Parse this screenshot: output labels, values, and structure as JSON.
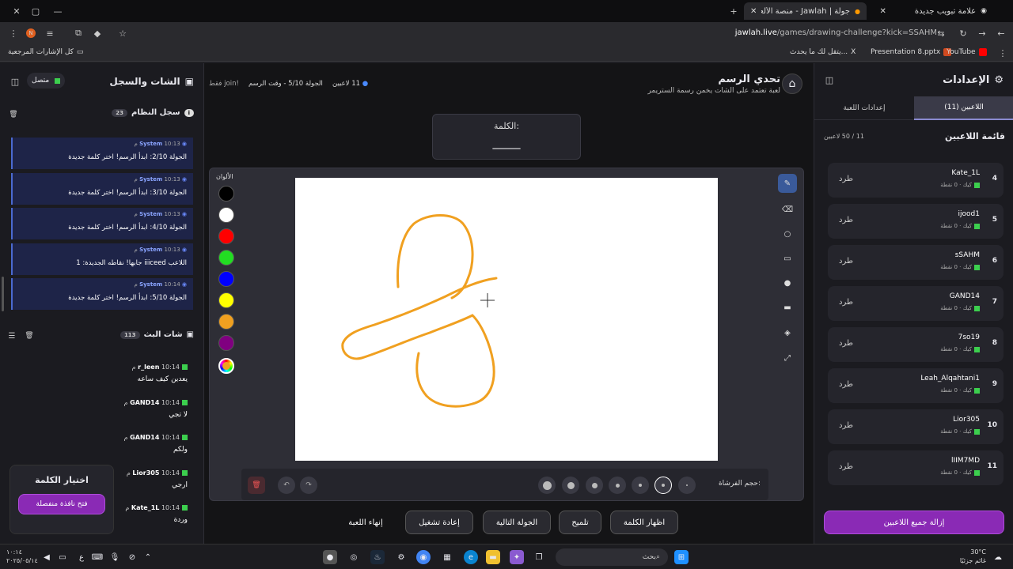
{
  "browser": {
    "tabs": [
      {
        "label": "علامة تبويب جديدة",
        "active": false
      },
      {
        "label": "جولة | Jawlah - منصة الألعاب الت...",
        "active": true
      }
    ],
    "url_host": "jawlah.live",
    "url_path": "/games/drawing-challenge?kick=SSAHM",
    "bookmarks": [
      "YouTube",
      "Presentation 8.pptx",
      "يتقل لك ما يحدث...",
      "كل الإشارات المرجعية"
    ],
    "bookmark_x": "X"
  },
  "settings": {
    "title": "الإعدادات",
    "tab_players": "اللاعبين (11)",
    "tab_game": "إعدادات اللعبة",
    "list_title": "قائمة اللاعبين",
    "list_count": "11 / 50 لاعبين",
    "kick_label": "طرد",
    "meta_platform": "كيك",
    "meta_points": "0 نقطة",
    "players": [
      {
        "idx": "4",
        "name": "Kate_1L"
      },
      {
        "idx": "5",
        "name": "ijood1"
      },
      {
        "idx": "6",
        "name": "sSAHM"
      },
      {
        "idx": "7",
        "name": "GAND14"
      },
      {
        "idx": "8",
        "name": "7so19"
      },
      {
        "idx": "9",
        "name": "Leah_Alqahtani1"
      },
      {
        "idx": "10",
        "name": "Lior305"
      },
      {
        "idx": "11",
        "name": "lIIM7MD"
      }
    ],
    "remove_all": "إزالة جميع اللاعبين"
  },
  "game": {
    "title": "تحدي الرسم",
    "subtitle": "لعبة تعتمد على الشات يخمن رسمة الستريمر",
    "players_count": "11 لاعبين",
    "round_info": "الجولة 5/10 - وقت الرسم",
    "join_hint": "!join فقط",
    "word_label": "الكلمة:",
    "word_mask": "_____",
    "colors_label": "الألوان",
    "brush_size_label": "حجم الفرشاة:",
    "colors": [
      "#000000",
      "#ffffff",
      "#ff0000",
      "#22dd22",
      "#0000ff",
      "#ffff00",
      "#f0a020",
      "#800080"
    ],
    "stroke_color": "#f0a020",
    "actions": {
      "show_word": "اظهار الكلمة",
      "hint": "تلميح",
      "next_round": "الجولة التالية",
      "restart": "إعادة تشغيل",
      "end_game": "إنهاء اللعبة"
    }
  },
  "left": {
    "title": "الشات والسجل",
    "status": "متصل",
    "system_log_title": "سجل النظام",
    "system_log_count": "23",
    "system_name": "System",
    "logs": [
      {
        "time": "10:13 م",
        "text": "الجولة 2/10: ابدأ الرسم! اختر كلمة جديدة"
      },
      {
        "time": "10:13 م",
        "text": "الجولة 3/10: ابدأ الرسم! اختر كلمة جديدة"
      },
      {
        "time": "10:13 م",
        "text": "الجولة 4/10: ابدأ الرسم! اختر كلمة جديدة"
      },
      {
        "time": "10:13 م",
        "text": "اللاعب iiiceed جابها! نقاطه الجديدة: 1"
      },
      {
        "time": "10:14 م",
        "text": "الجولة 5/10: ابدأ الرسم! اختر كلمة جديدة"
      }
    ],
    "chat_title": "شات البث",
    "chat_count": "113",
    "chat": [
      {
        "user": "r_leen",
        "time": "10:14 م",
        "text": "يعدين كيف ساعه"
      },
      {
        "user": "GAND14",
        "time": "10:14 م",
        "text": "لا تجي"
      },
      {
        "user": "GAND14",
        "time": "10:14 م",
        "text": "ولكم"
      },
      {
        "user": "Lior305",
        "time": "10:14 م",
        "text": "ارجي"
      },
      {
        "user": "Kate_1L",
        "time": "10:14 م",
        "text": "وردة"
      }
    ],
    "word_pick_title": "اختيار الكلمة",
    "word_pick_button": "فتح نافذة منفصلة"
  },
  "taskbar": {
    "search": "بحث",
    "weather_temp": "30°C",
    "weather_desc": "غائم جزئيًا",
    "time": "١٠:١٤",
    "date": "٢٠٢٥/٠٥/١٤"
  }
}
